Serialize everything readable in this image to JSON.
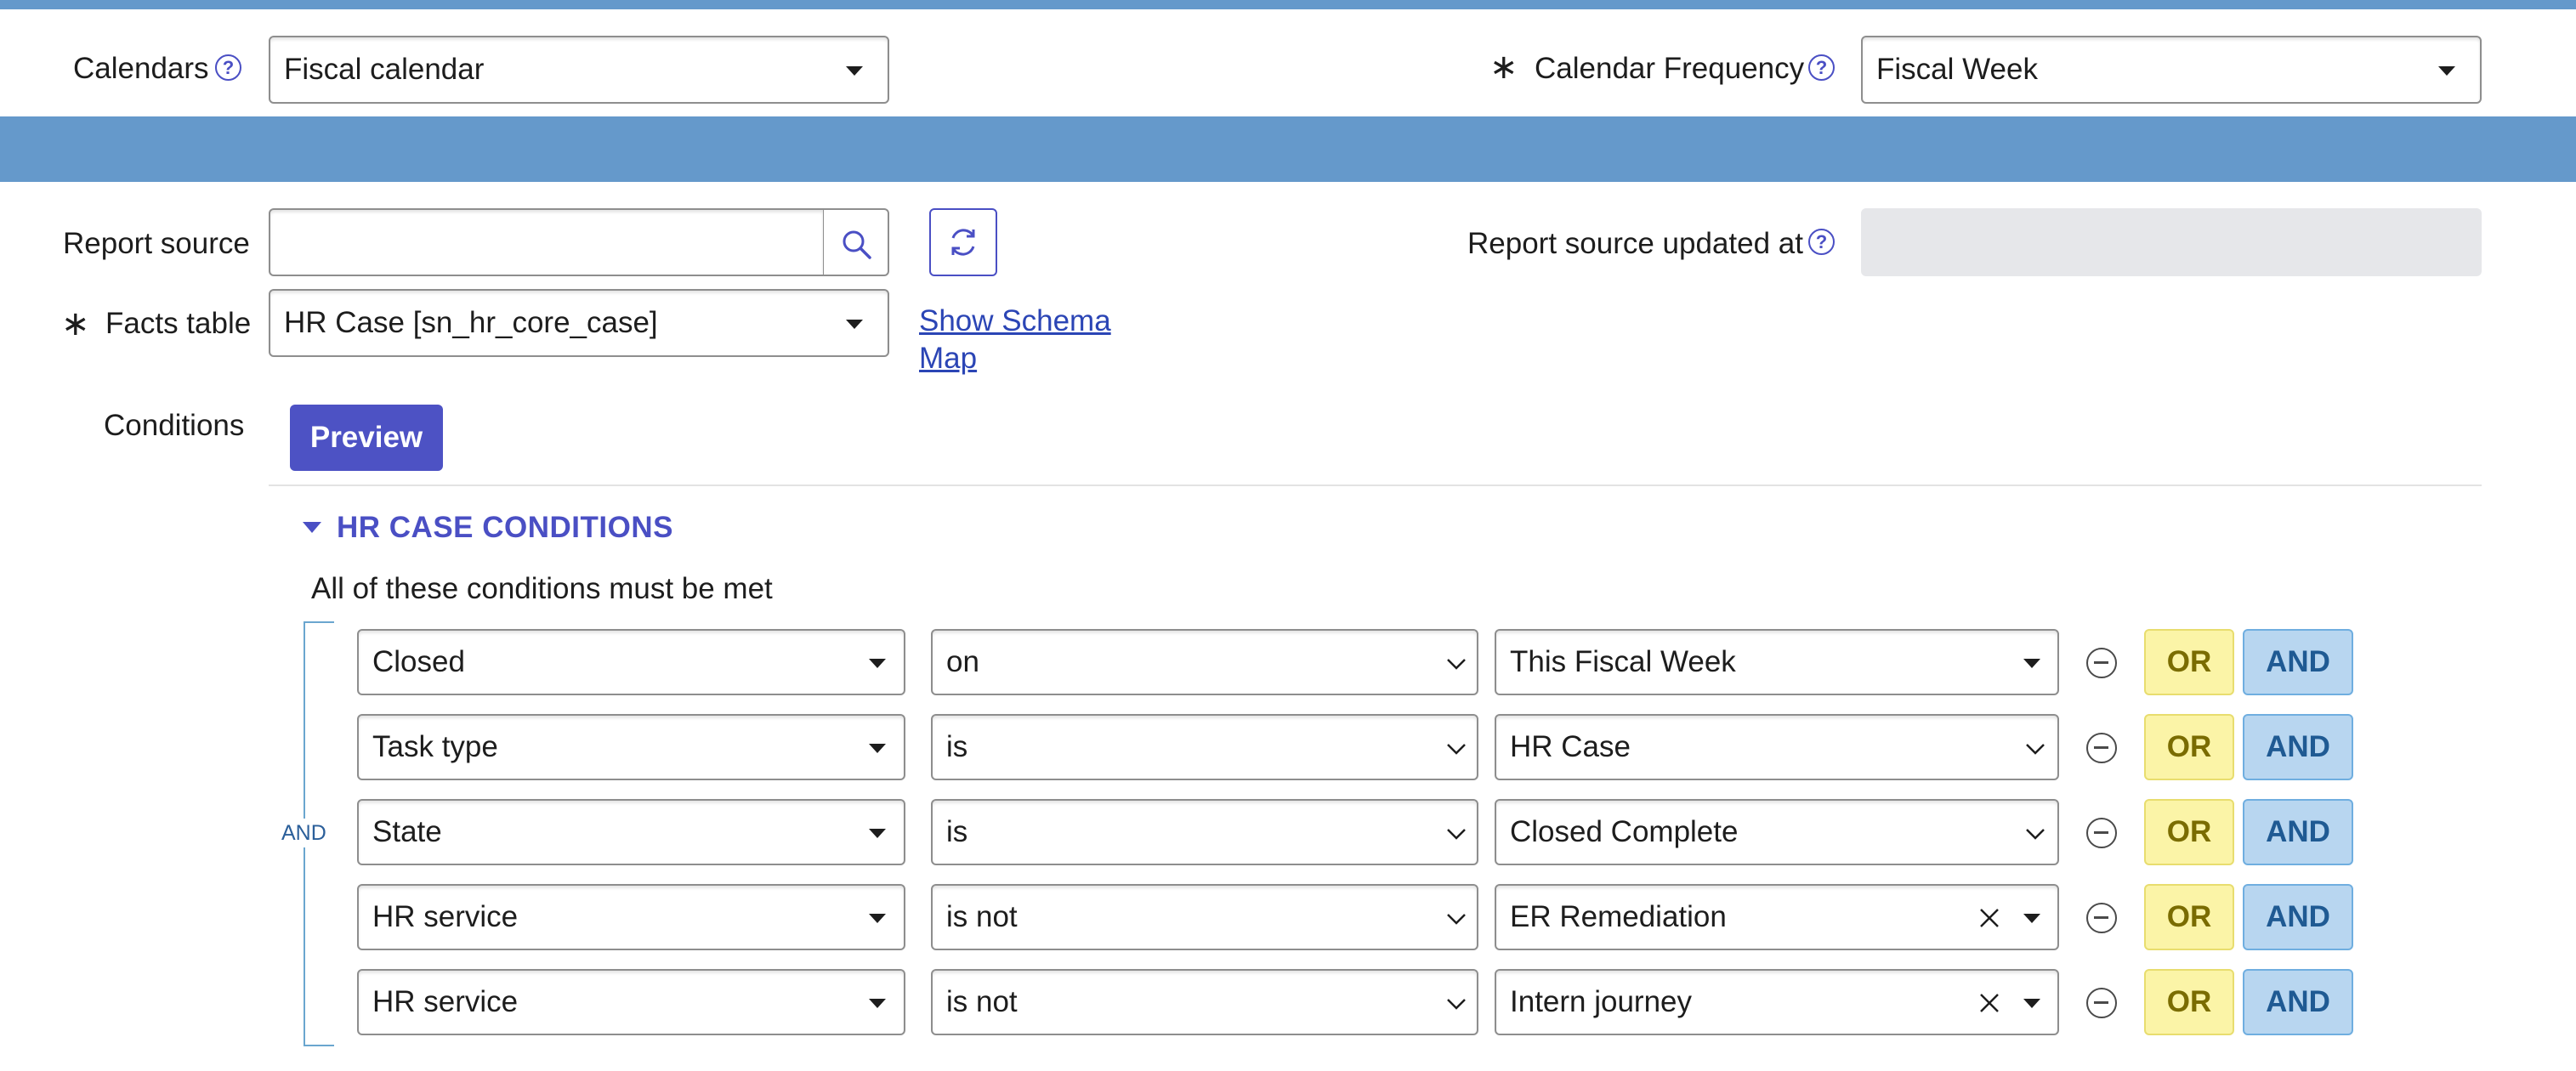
{
  "colors": {
    "header_blue": "#6599cb",
    "accent": "#4a4fc4",
    "or_yellow": "#fbf4a7",
    "and_blue": "#b8d6f0"
  },
  "calendars": {
    "label": "Calendars",
    "value": "Fiscal calendar"
  },
  "calendar_frequency": {
    "label": "Calendar Frequency",
    "required_mark": "∗",
    "value": "Fiscal Week"
  },
  "report_source": {
    "label": "Report source",
    "value": "",
    "placeholder": ""
  },
  "report_source_updated": {
    "label": "Report source updated at",
    "value": ""
  },
  "facts_table": {
    "label": "Facts table",
    "required_mark": "∗",
    "value": "HR Case [sn_hr_core_case]",
    "schema_link_line1": "Show Schema",
    "schema_link_line2": "Map"
  },
  "conditions": {
    "label": "Conditions",
    "preview_label": "Preview",
    "section_title": "HR CASE CONDITIONS",
    "note": "All of these conditions must be met",
    "group_operator": "AND",
    "or_label": "OR",
    "and_label": "AND",
    "rows": [
      {
        "field": "Closed",
        "operator": "on",
        "value": "This Fiscal Week",
        "value_control": "caret"
      },
      {
        "field": "Task type",
        "operator": "is",
        "value": "HR Case",
        "value_control": "chevron"
      },
      {
        "field": "State",
        "operator": "is",
        "value": "Closed Complete",
        "value_control": "chevron"
      },
      {
        "field": "HR service",
        "operator": "is not",
        "value": "ER Remediation",
        "value_control": "clear-caret"
      },
      {
        "field": "HR service",
        "operator": "is not",
        "value": "Intern journey",
        "value_control": "clear-caret"
      }
    ]
  },
  "icons": {
    "help": "question-circle-icon",
    "search": "search-icon",
    "refresh": "refresh-icon",
    "remove": "minus-circle-icon",
    "clear": "close-icon",
    "dropdown": "caret-down-icon",
    "section_toggle": "triangle-down-icon"
  }
}
